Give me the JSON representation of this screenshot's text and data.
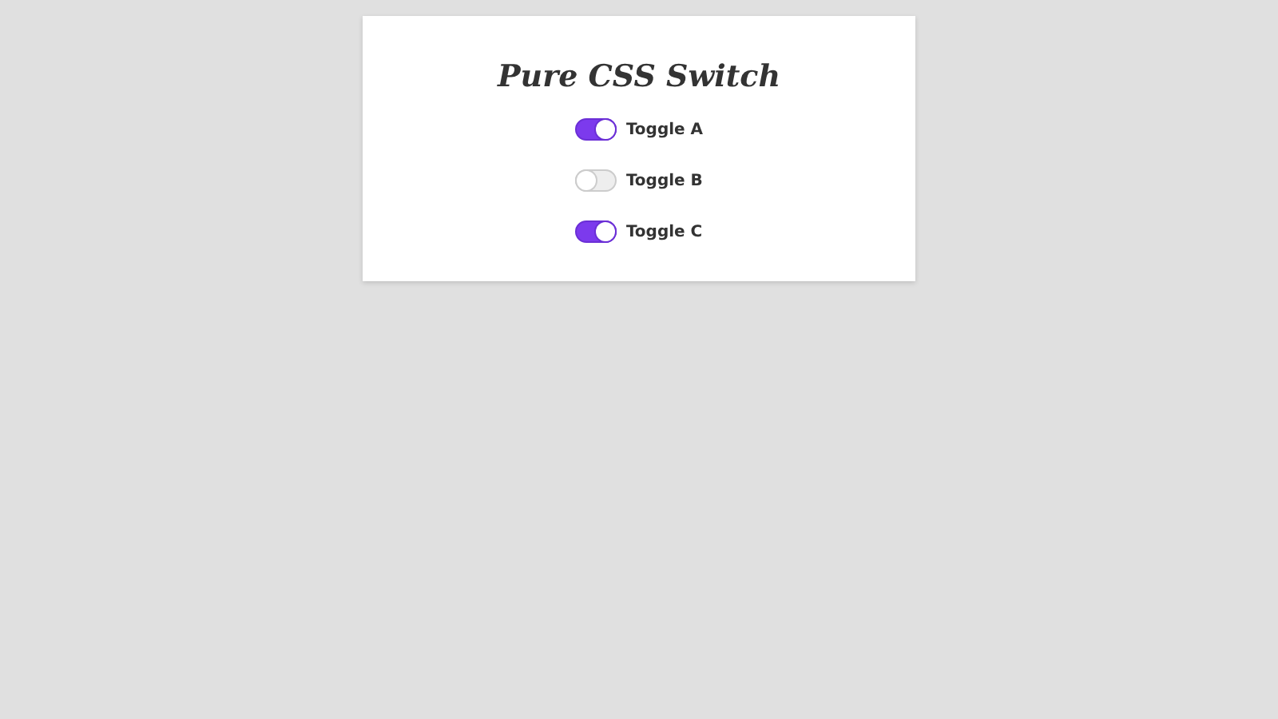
{
  "title": "Pure CSS Switch",
  "toggles": [
    {
      "label": "Toggle A",
      "on": true
    },
    {
      "label": "Toggle B",
      "on": false
    },
    {
      "label": "Toggle C",
      "on": true
    }
  ]
}
